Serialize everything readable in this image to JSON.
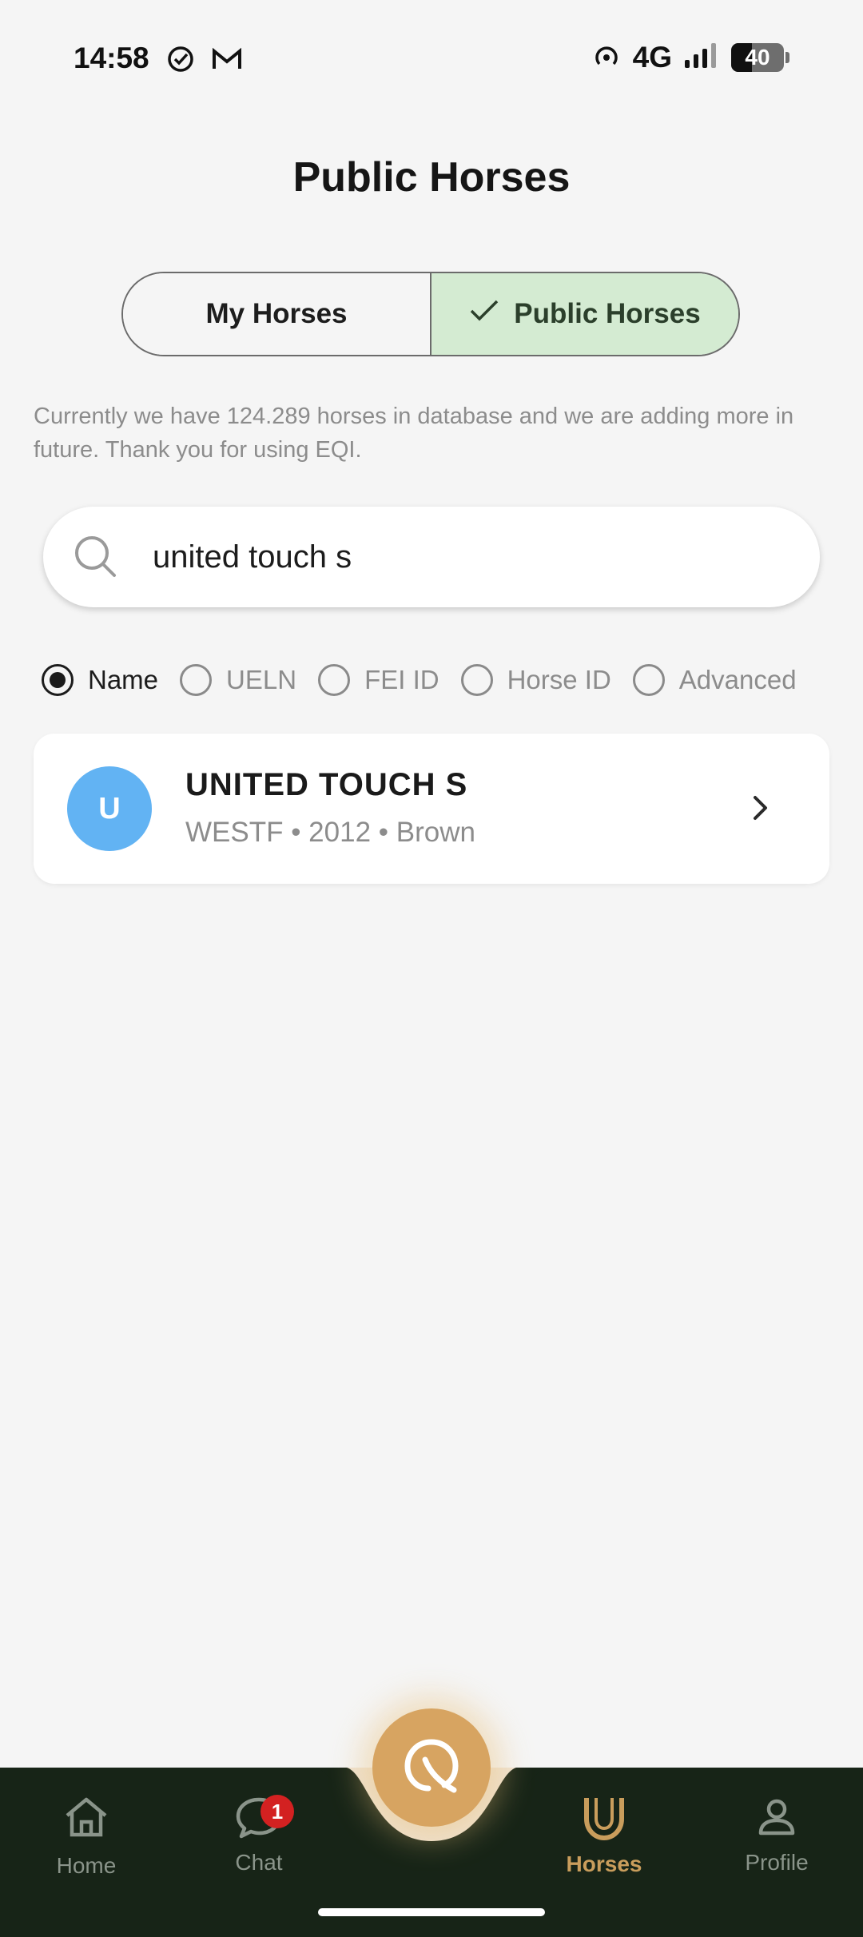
{
  "status_bar": {
    "time": "14:58",
    "network": "4G",
    "battery": "40",
    "icons": [
      "check-circle-icon",
      "gmail-icon",
      "hotspot-icon",
      "signal-icon",
      "battery-icon"
    ]
  },
  "page": {
    "title": "Public Horses"
  },
  "toggle": {
    "left_label": "My Horses",
    "right_label": "Public Horses",
    "selected": "Public Horses"
  },
  "info": {
    "text": "Currently we have 124.289 horses in database and we are adding more in future. Thank you for using EQI."
  },
  "search": {
    "value": "united touch s",
    "icon": "search-icon"
  },
  "filters": {
    "options": [
      "Name",
      "UELN",
      "FEI ID",
      "Horse ID",
      "Advanced"
    ],
    "selected": "Name"
  },
  "results": [
    {
      "initial": "U",
      "name": "UNITED TOUCH S",
      "details": "WESTF • 2012 • Brown",
      "avatar_color": "#62b3f3"
    }
  ],
  "bottom_nav": {
    "items": [
      {
        "label": "Home",
        "icon": "home-icon",
        "active": false
      },
      {
        "label": "Chat",
        "icon": "chat-icon",
        "active": false,
        "badge": "1"
      },
      {
        "label": "Horses",
        "icon": "horseshoe-icon",
        "active": true
      },
      {
        "label": "Profile",
        "icon": "profile-icon",
        "active": false
      }
    ],
    "center_icon": "eqi-logo-icon"
  },
  "colors": {
    "background": "#f5f5f5",
    "toggle_selected": "#d4ebd2",
    "nav_background": "#172417",
    "accent_gold": "#d7a461",
    "avatar_blue": "#62b3f3",
    "badge_red": "#d32121"
  }
}
